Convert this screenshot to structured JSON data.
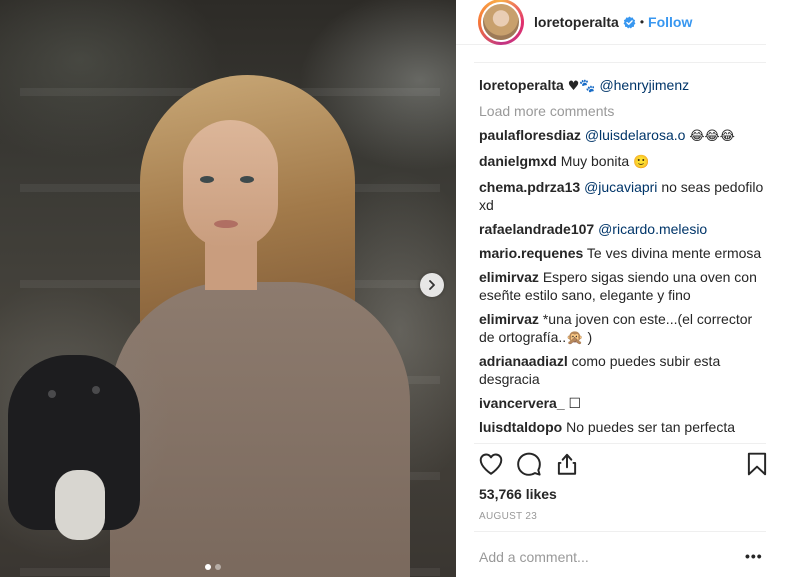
{
  "post": {
    "username": "loretoperalta",
    "separator": "•",
    "follow_label": "Follow",
    "caption": {
      "user": "loretoperalta",
      "emoji": "♥🐾",
      "mention": "@henryjimenz"
    },
    "load_more_label": "Load more comments",
    "comments": [
      {
        "user": "paulafloresdiaz",
        "mention": "@luisdelarosa.o",
        "text": "",
        "emoji": "😂😂😂"
      },
      {
        "user": "danielgmxd",
        "mention": "",
        "text": "Muy bonita",
        "emoji": "🙂"
      },
      {
        "user": "chema.pdrza13",
        "mention": "@jucaviapri",
        "text": "no seas pedofilo xd",
        "emoji": ""
      },
      {
        "user": "rafaelandrade107",
        "mention": "@ricardo.melesio",
        "text": "",
        "emoji": ""
      },
      {
        "user": "mario.requenes",
        "mention": "",
        "text": "Te ves divina mente ermosa",
        "emoji": ""
      },
      {
        "user": "elimirvaz",
        "mention": "",
        "text": "Espero sigas siendo una oven con eseñte estilo sano, elegante y fino",
        "emoji": ""
      },
      {
        "user": "elimirvaz",
        "mention": "",
        "text": "*una joven con este...(el corrector de ortografía..🙊 )",
        "emoji": ""
      },
      {
        "user": "adrianaadiazl",
        "mention": "",
        "text": "como puedes subir esta desgracia",
        "emoji": ""
      },
      {
        "user": "ivancervera_",
        "mention": "",
        "text": "☐",
        "emoji": ""
      },
      {
        "user": "luisdtaldopo",
        "mention": "",
        "text": "No puedes ser tan perfecta",
        "emoji": ""
      }
    ],
    "likes": "53,766 likes",
    "date": "AUGUST 23",
    "add_comment_placeholder": "Add a comment...",
    "more_options": "•••"
  },
  "colors": {
    "accent": "#3897f0",
    "mention": "#003569",
    "muted": "#999999",
    "text": "#262626"
  },
  "icons": [
    "chevron-right-icon",
    "verified-badge-icon",
    "heart-icon",
    "comment-icon",
    "share-icon",
    "bookmark-icon"
  ]
}
